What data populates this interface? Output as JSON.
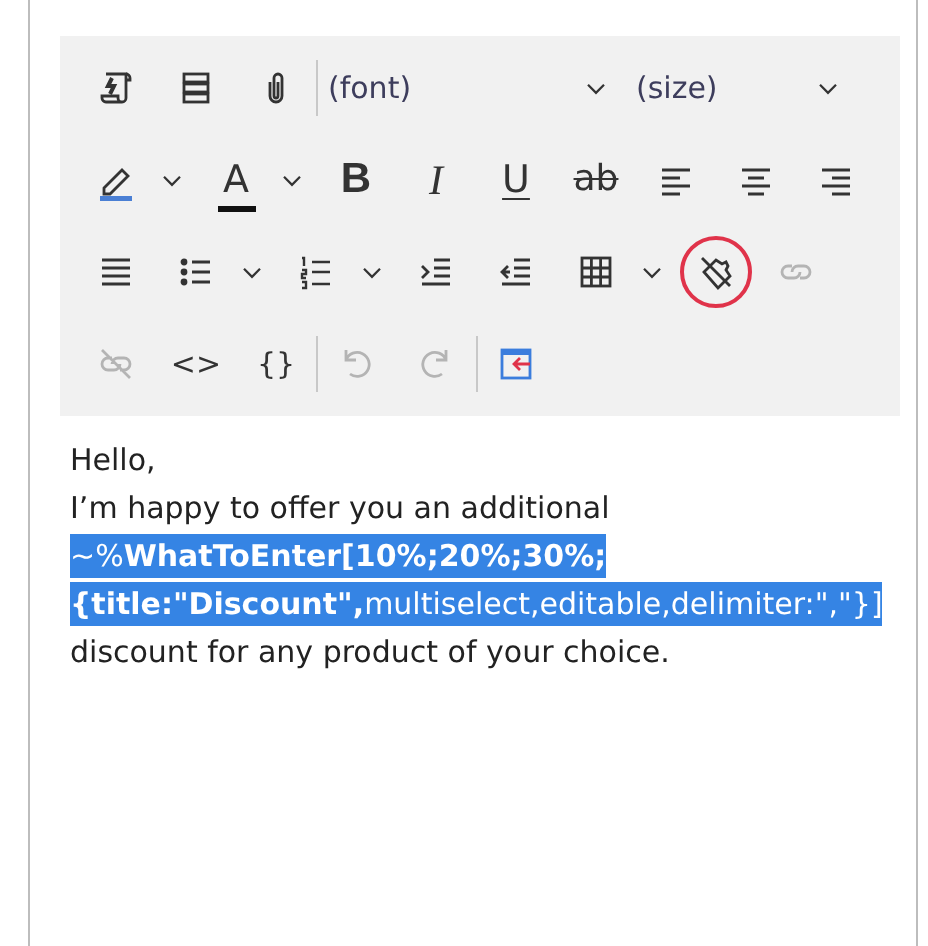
{
  "toolbar": {
    "rows": [
      {
        "items": [
          {
            "kind": "button",
            "disabled": false,
            "circled": false
          },
          {
            "kind": "button",
            "disabled": false,
            "circled": false
          },
          {
            "kind": "button",
            "disabled": false,
            "circled": false
          },
          {
            "kind": "separator"
          },
          {
            "kind": "dropdown",
            "value": "(font)"
          },
          {
            "kind": "dropdown",
            "value": "(size)"
          }
        ]
      },
      {
        "items": [
          {
            "kind": "split",
            "color": "#4a7fd4",
            "disabled": false,
            "circled": false
          },
          {
            "kind": "split",
            "label": "A",
            "color": "#111111",
            "disabled": false,
            "circled": false
          },
          {
            "kind": "button",
            "label": "B",
            "disabled": false,
            "circled": false
          },
          {
            "kind": "button",
            "label": "I",
            "disabled": false,
            "circled": false
          },
          {
            "kind": "button",
            "label": "U",
            "disabled": false,
            "circled": false
          },
          {
            "kind": "button",
            "label": "ab",
            "disabled": false,
            "circled": false
          },
          {
            "kind": "button",
            "disabled": false,
            "circled": false
          },
          {
            "kind": "button",
            "disabled": false,
            "circled": false
          },
          {
            "kind": "button",
            "disabled": false,
            "circled": false
          }
        ]
      },
      {
        "items": [
          {
            "kind": "button",
            "disabled": false,
            "circled": false
          },
          {
            "kind": "split",
            "disabled": false,
            "circled": false
          },
          {
            "kind": "split",
            "disabled": false,
            "circled": false
          },
          {
            "kind": "button",
            "disabled": false,
            "circled": false
          },
          {
            "kind": "button",
            "disabled": false,
            "circled": false
          },
          {
            "kind": "split",
            "disabled": false,
            "circled": false
          },
          {
            "kind": "button",
            "disabled": false,
            "circled": true
          },
          {
            "kind": "button",
            "disabled": true,
            "circled": false
          }
        ]
      },
      {
        "items": [
          {
            "kind": "button",
            "disabled": true,
            "circled": false
          },
          {
            "kind": "button",
            "label": "<>",
            "disabled": false,
            "circled": false
          },
          {
            "kind": "button",
            "label": "{}",
            "disabled": false,
            "circled": false
          },
          {
            "kind": "separator"
          },
          {
            "kind": "button",
            "disabled": true,
            "circled": false
          },
          {
            "kind": "button",
            "disabled": true,
            "circled": false
          },
          {
            "kind": "separator"
          },
          {
            "kind": "button",
            "disabled": false,
            "circled": false
          }
        ]
      }
    ]
  },
  "editor": {
    "lines": [
      {
        "text": "Hello,",
        "selected": false
      },
      {
        "text": "I’m happy to offer you an additional",
        "selected": false
      },
      {
        "text": "~%**WhatToEnter[10%;20%;30%;**",
        "selected": true
      },
      {
        "text": "**{title:\"Discount\",**multiselect,editable,delimiter:\",\"}]",
        "selected": true
      },
      {
        "text": "discount for any product of your choice.",
        "selected": false
      }
    ]
  }
}
